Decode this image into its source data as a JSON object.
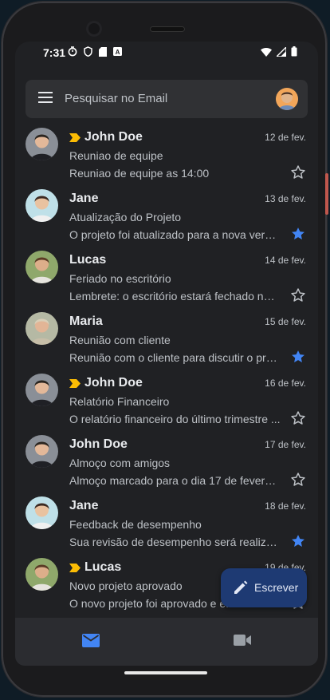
{
  "status_bar": {
    "time": "7:31",
    "left_icons": [
      "timer-icon",
      "shield-icon",
      "sd-card-icon",
      "a-square-icon"
    ],
    "right_icons": [
      "wifi-icon",
      "signal-icon",
      "battery-icon"
    ]
  },
  "search": {
    "placeholder": "Pesquisar no Email",
    "menu_icon": "hamburger-menu-icon",
    "account_avatar": "profile-avatar"
  },
  "colors": {
    "background": "#202124",
    "surface": "#303134",
    "important_marker": "#fbbc04",
    "star_active": "#4285f4",
    "fab": "#1e3a73"
  },
  "emails": [
    {
      "sender": "John Doe",
      "important": true,
      "date": "12 de fev.",
      "subject": "Reuniao de equipe",
      "snippet": "Reuniao de equipe as 14:00",
      "starred": false
    },
    {
      "sender": "Jane",
      "important": false,
      "date": "13 de fev.",
      "subject": "Atualização do Projeto",
      "snippet": "O projeto foi atualizado para a nova versão.",
      "starred": true
    },
    {
      "sender": "Lucas",
      "important": false,
      "date": "14 de fev.",
      "subject": "Feriado no escritório",
      "snippet": "Lembrete: o escritório estará fechado no ...",
      "starred": false
    },
    {
      "sender": "Maria",
      "important": false,
      "date": "15 de fev.",
      "subject": "Reunião com cliente",
      "snippet": "Reunião com o cliente para discutir o pró...",
      "starred": true
    },
    {
      "sender": "John Doe",
      "important": true,
      "date": "16 de fev.",
      "subject": "Relatório Financeiro",
      "snippet": "O relatório financeiro do último trimestre ...",
      "starred": false
    },
    {
      "sender": "John Doe",
      "important": false,
      "date": "17 de fev.",
      "subject": "Almoço com amigos",
      "snippet": "Almoço marcado para o dia 17 de fevereir...",
      "starred": false
    },
    {
      "sender": "Jane",
      "important": false,
      "date": "18 de fev.",
      "subject": "Feedback de desempenho",
      "snippet": "Sua revisão de desempenho será realizad...",
      "starred": true
    },
    {
      "sender": "Lucas",
      "important": true,
      "date": "19 de fev.",
      "subject": "Novo projeto aprovado",
      "snippet": "O novo projeto foi aprovado e e...",
      "starred": false
    }
  ],
  "fab": {
    "label": "Escrever",
    "icon": "pencil-icon"
  },
  "bottom_nav": {
    "items": [
      "mail-icon",
      "video-camera-icon"
    ],
    "active": "mail-icon"
  }
}
